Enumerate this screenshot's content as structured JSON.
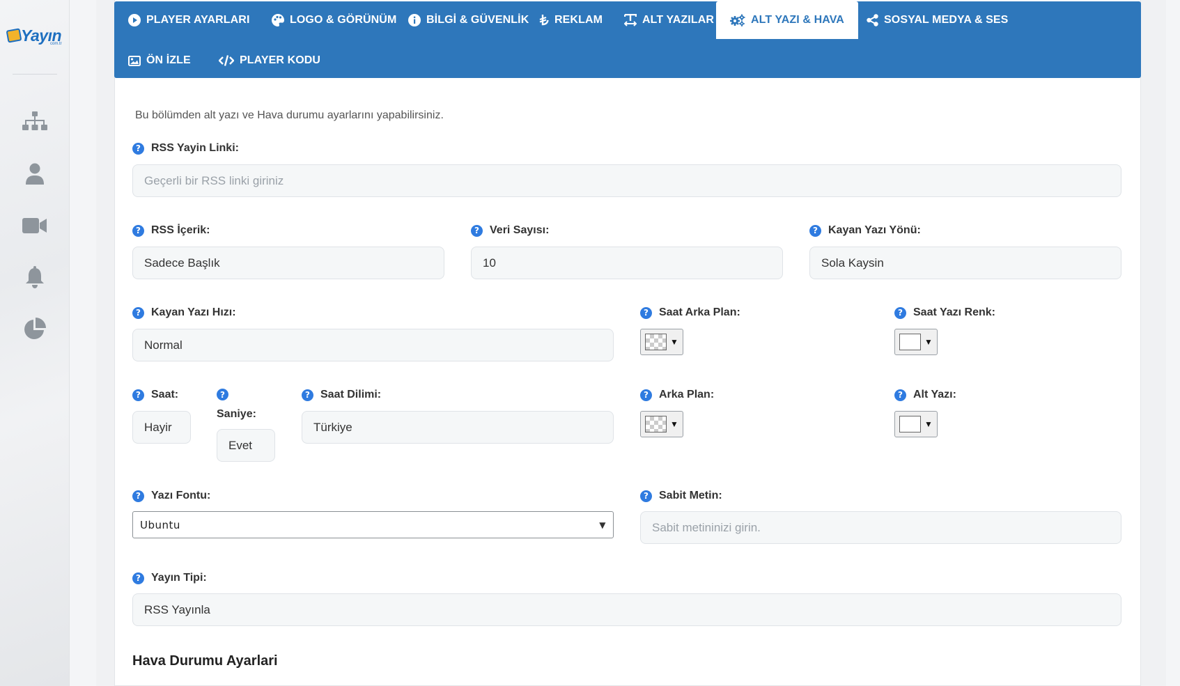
{
  "brand": {
    "name": "Yayın",
    "suffix": "com.tr"
  },
  "sidebar": {
    "items": [
      {
        "icon": "sitemap-icon"
      },
      {
        "icon": "user-icon"
      },
      {
        "icon": "video-camera-icon"
      },
      {
        "icon": "bell-icon"
      },
      {
        "icon": "pie-chart-icon"
      }
    ]
  },
  "tabs": [
    {
      "label": "PLAYER AYARLARI",
      "icon": "play-circle-icon"
    },
    {
      "label": "LOGO & GÖRÜNÜM",
      "icon": "palette-icon"
    },
    {
      "label": "BİLGİ & GÜVENLİK",
      "icon": "info-circle-icon"
    },
    {
      "label": "REKLAM",
      "icon": "lira-icon"
    },
    {
      "label": "ALT YAZILAR",
      "icon": "text-width-icon"
    },
    {
      "label": "ALT YAZI & HAVA",
      "icon": "cogs-icon",
      "active": true
    },
    {
      "label": "SOSYAL MEDYA & SES",
      "icon": "share-icon"
    },
    {
      "label": "ÖN İZLE",
      "icon": "image-icon"
    },
    {
      "label": "PLAYER KODU",
      "icon": "code-icon"
    }
  ],
  "form": {
    "intro": "Bu bölümden alt yazı ve Hava durumu ayarlarını yapabilirsiniz.",
    "rss_link": {
      "label": "RSS Yayin Linki:",
      "placeholder": "Geçerli bir RSS linki giriniz"
    },
    "rss_content": {
      "label": "RSS İçerik:",
      "value": "Sadece Başlık"
    },
    "data_count": {
      "label": "Veri Sayısı:",
      "value": "10"
    },
    "scroll_direction": {
      "label": "Kayan Yazı Yönü:",
      "value": "Sola Kaysin"
    },
    "scroll_speed": {
      "label": "Kayan Yazı Hızı:",
      "value": "Normal"
    },
    "clock_bg": {
      "label": "Saat Arka Plan:"
    },
    "clock_text_color": {
      "label": "Saat Yazı Renk:"
    },
    "clock": {
      "label": "Saat:",
      "value": "Hayir"
    },
    "seconds": {
      "label": "Saniye:",
      "value": "Evet"
    },
    "timezone": {
      "label": "Saat Dilimi:",
      "value": "Türkiye"
    },
    "background": {
      "label": "Arka Plan:"
    },
    "subtitle": {
      "label": "Alt Yazı:"
    },
    "font": {
      "label": "Yazı Fontu:",
      "value": "Ubuntu"
    },
    "fixed_text": {
      "label": "Sabit Metin:",
      "placeholder": "Sabit metininizi girin."
    },
    "broadcast_type": {
      "label": "Yayın Tipi:",
      "value": "RSS Yayınla"
    },
    "weather_section": "Hava Durumu Ayarlari"
  },
  "colors": {
    "primary": "#2e77bb",
    "help": "#2f7be0"
  }
}
